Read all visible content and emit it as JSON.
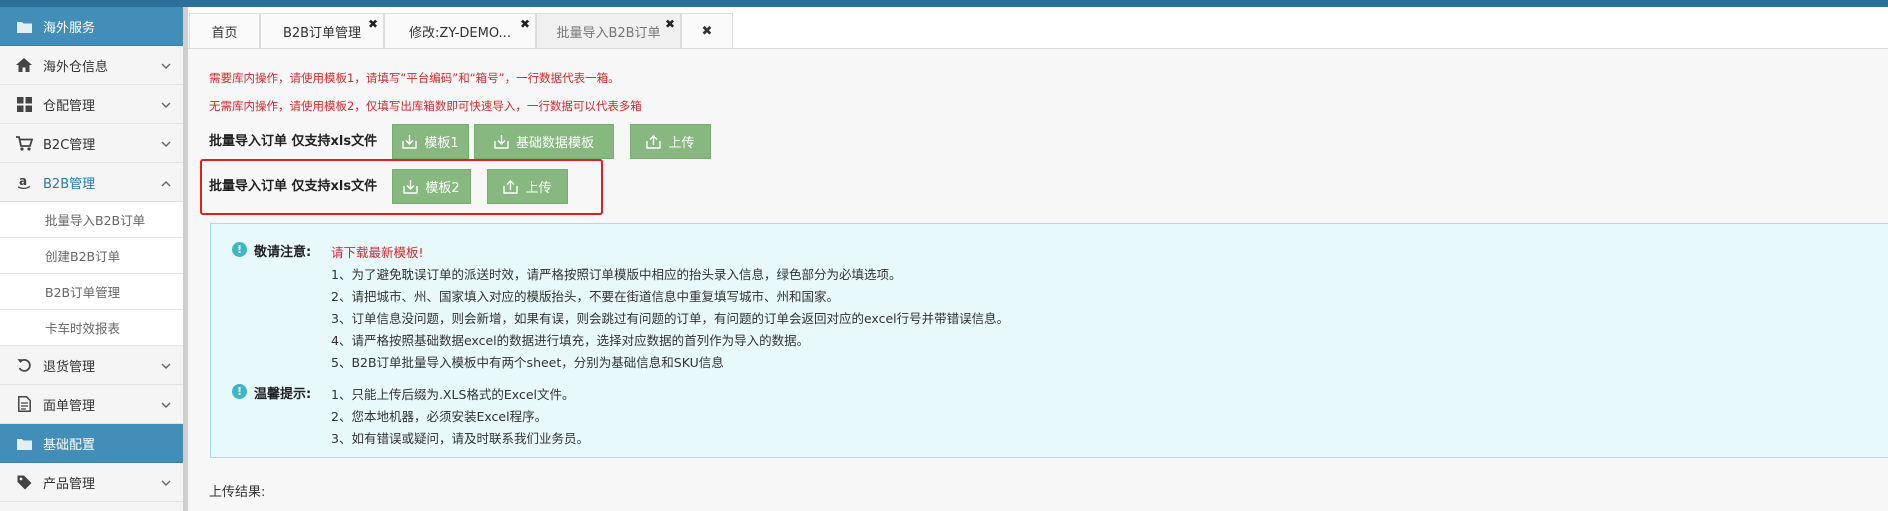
{
  "sidebar": {
    "sections": [
      {
        "label": "海外服务",
        "icon": "folder-icon"
      },
      {
        "label": "基础配置",
        "icon": "folder-icon"
      }
    ],
    "items": [
      {
        "label": "海外仓信息",
        "icon": "home-icon"
      },
      {
        "label": "仓配管理",
        "icon": "grid-icon"
      },
      {
        "label": "B2C管理",
        "icon": "cart-icon"
      },
      {
        "label": "B2B管理",
        "icon": "amazon-icon"
      },
      {
        "label": "退货管理",
        "icon": "undo-icon"
      },
      {
        "label": "面单管理",
        "icon": "document-icon"
      },
      {
        "label": "产品管理",
        "icon": "tag-icon"
      }
    ],
    "sub_items": [
      {
        "label": "批量导入B2B订单"
      },
      {
        "label": "创建B2B订单"
      },
      {
        "label": "B2B订单管理"
      },
      {
        "label": "卡车时效报表"
      }
    ]
  },
  "tabs": [
    {
      "label": "首页"
    },
    {
      "label": "B2B订单管理"
    },
    {
      "label": "修改:ZY-DEMO..."
    },
    {
      "label": "批量导入B2B订单"
    }
  ],
  "tab_close_symbol": "✖",
  "notes": {
    "line1": "需要库内操作，请使用模板1，请填写“平台编码”和“箱号”，一行数据代表一箱。",
    "line2": "无需库内操作，请使用模板2，仅填写出库箱数即可快速导入，一行数据可以代表多箱"
  },
  "import_rows": [
    {
      "label": "批量导入订单 仅支持xls文件",
      "buttons": [
        "模板1",
        "基础数据模板",
        "上传"
      ]
    },
    {
      "label": "批量导入订单 仅支持xls文件",
      "buttons": [
        "模板2",
        "上传"
      ]
    }
  ],
  "notice": {
    "title": "敬请注意:",
    "highlight": "请下载最新模板!",
    "lines": [
      "1、为了避免耽误订单的派送时效，请严格按照订单模版中相应的抬头录入信息，绿色部分为必填选项。",
      "2、请把城市、州、国家填入对应的模版抬头，不要在街道信息中重复填写城市、州和国家。",
      "3、订单信息没问题，则会新增，如果有误，则会跳过有问题的订单，有问题的订单会返回对应的excel行号并带错误信息。",
      "4、请严格按照基础数据excel的数据进行填充，选择对应数据的首列作为导入的数据。",
      "5、B2B订单批量导入模板中有两个sheet，分别为基础信息和SKU信息"
    ]
  },
  "tips": {
    "title": "温馨提示:",
    "lines": [
      "1、只能上传后缀为.XLS格式的Excel文件。",
      "2、您本地机器，必须安装Excel程序。",
      "3、如有错误或疑问，请及时联系我们业务员。"
    ]
  },
  "upload_result_label": "上传结果:",
  "colors": {
    "section_bg": "#438eb9",
    "button_green": "#87b87f",
    "note_red": "#d62b2b",
    "info_bg": "#e8f9fb",
    "highlight_border": "#e02020"
  }
}
